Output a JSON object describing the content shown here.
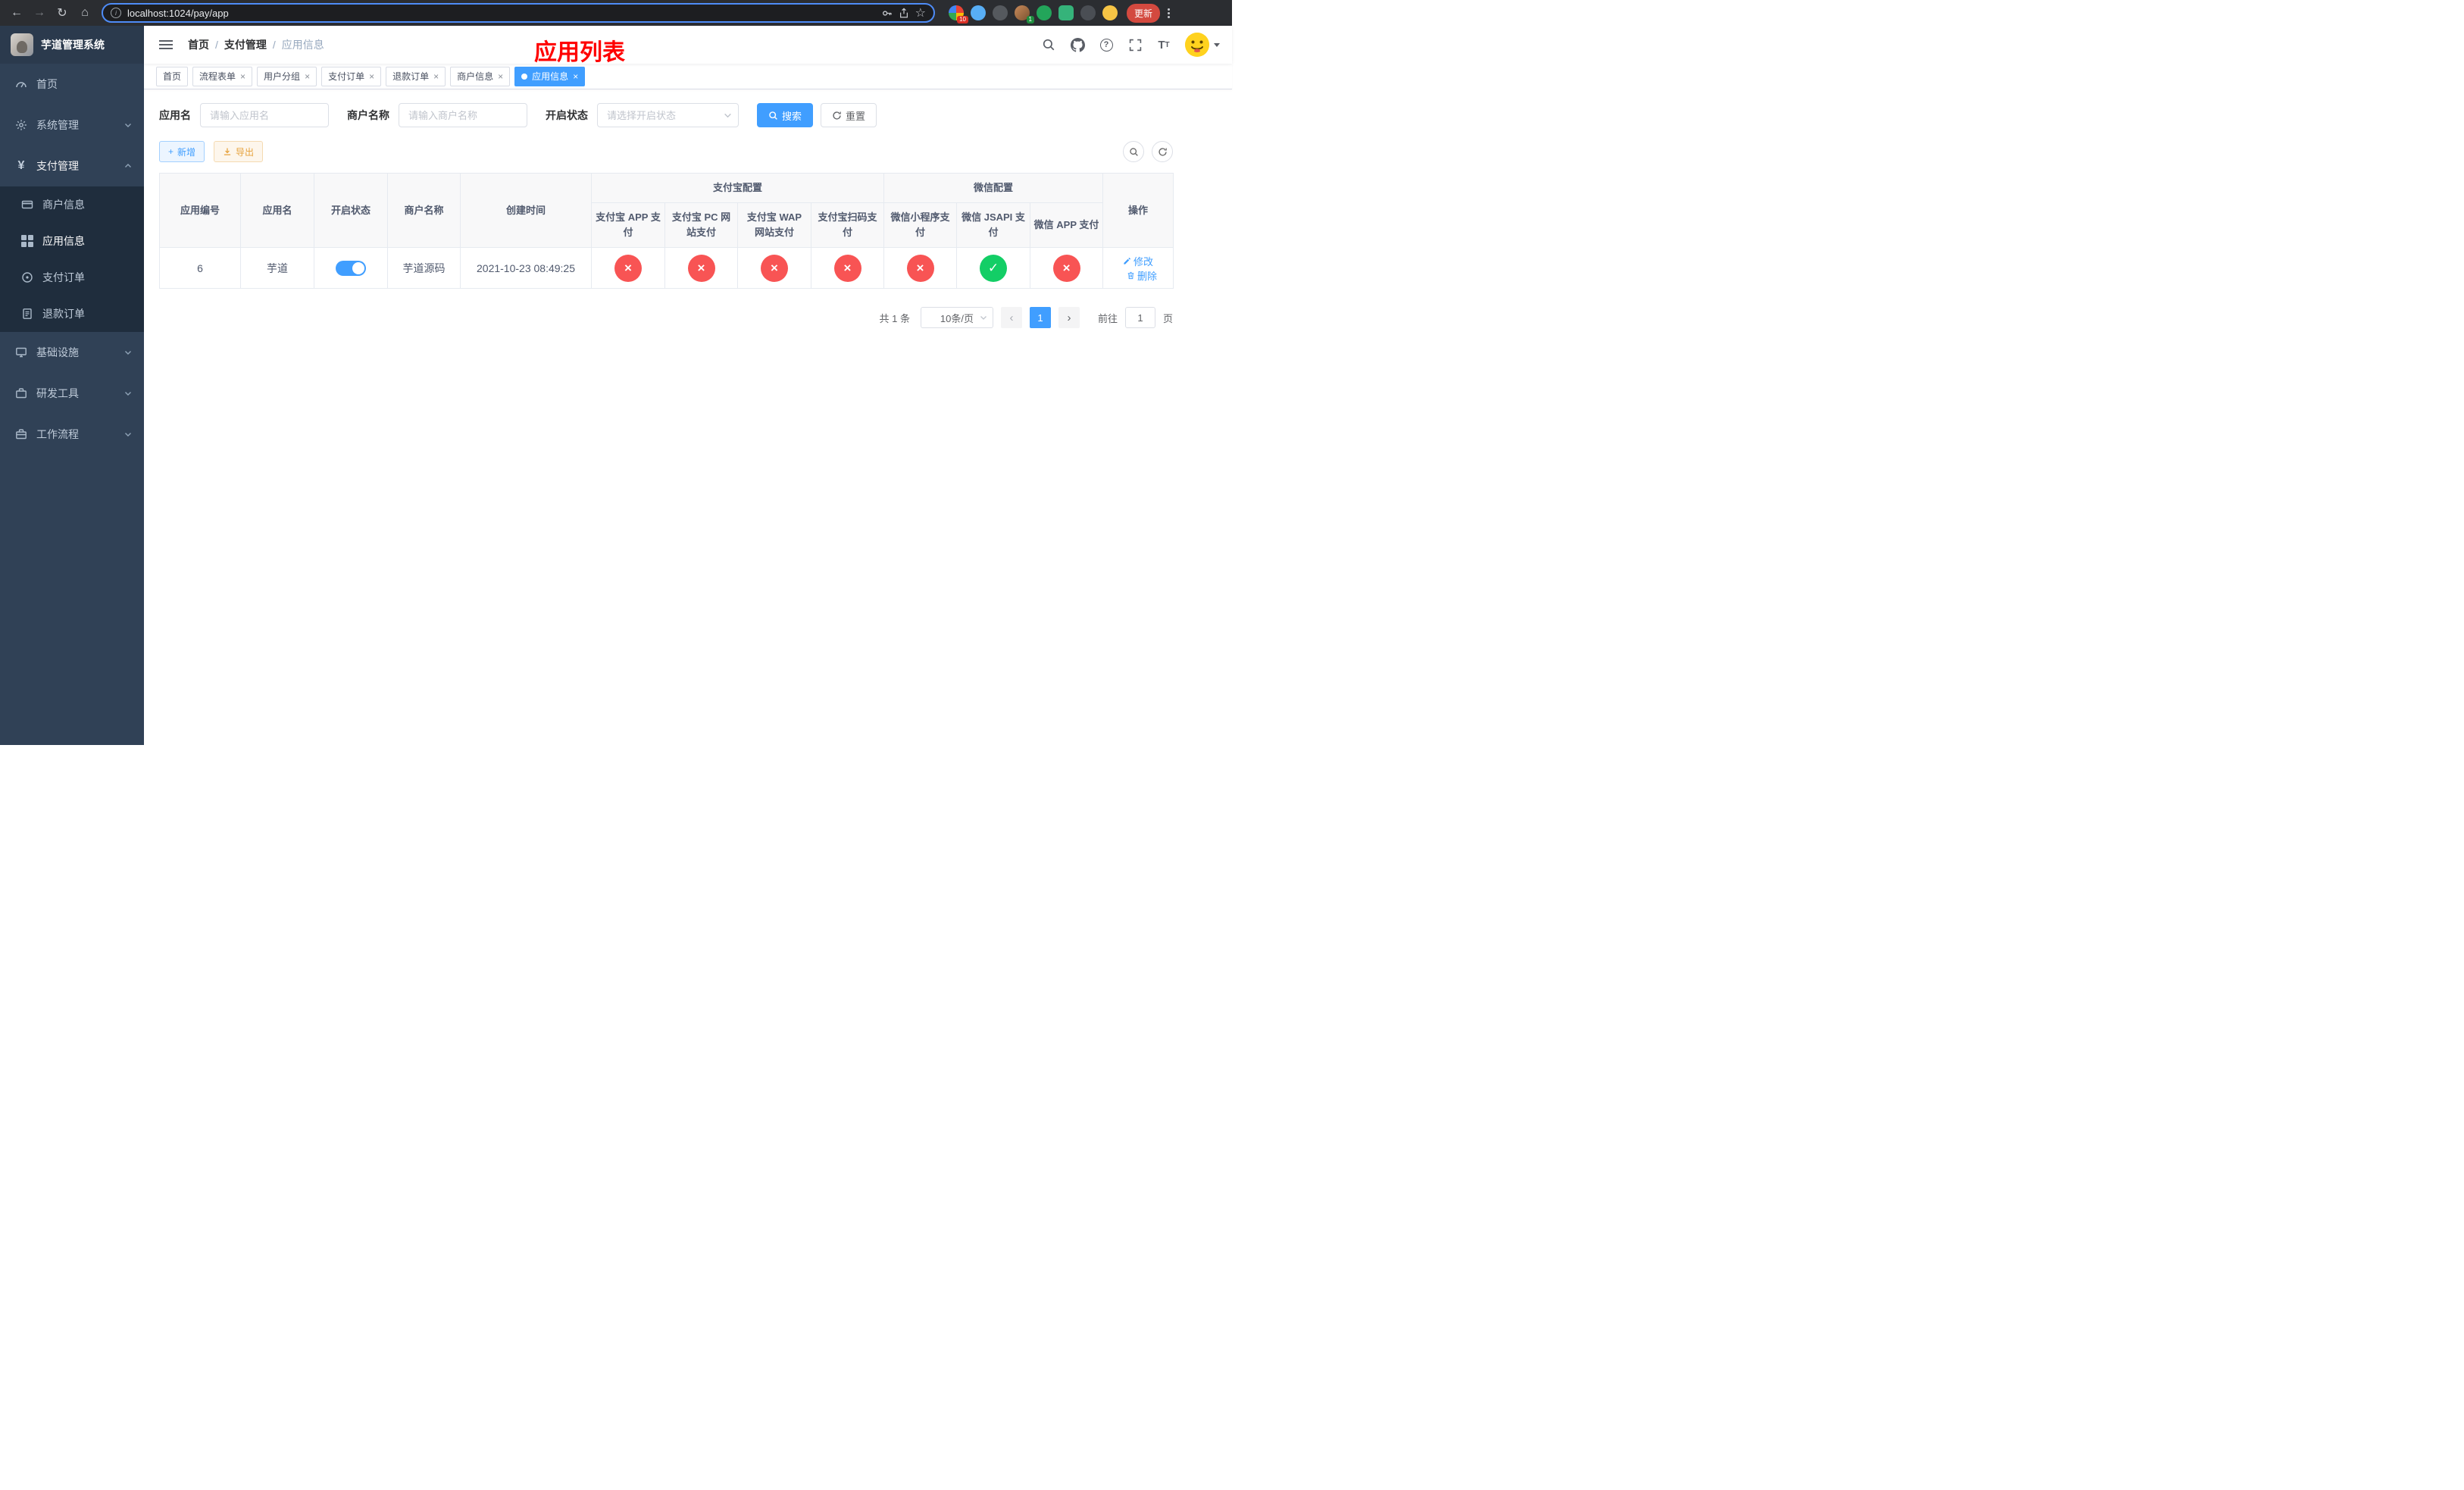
{
  "colors": {
    "accent": "#409eff",
    "danger": "#f85454",
    "success": "#13ce66",
    "warning": "#e6a23c",
    "title_red": "#ff0000"
  },
  "browser": {
    "url": "localhost:1024/pay/app",
    "update_label": "更新",
    "ext_badge_grid": "10",
    "ext_badge_avatar": "1"
  },
  "sidebar": {
    "title": "芋道管理系统",
    "menu": [
      {
        "label": "首页"
      },
      {
        "label": "系统管理"
      },
      {
        "label": "支付管理"
      },
      {
        "label": "基础设施"
      },
      {
        "label": "研发工具"
      },
      {
        "label": "工作流程"
      }
    ],
    "submenu": [
      {
        "label": "商户信息"
      },
      {
        "label": "应用信息"
      },
      {
        "label": "支付订单"
      },
      {
        "label": "退款订单"
      }
    ]
  },
  "header": {
    "breadcrumb": [
      {
        "label": "首页"
      },
      {
        "label": "支付管理"
      },
      {
        "label": "应用信息"
      }
    ],
    "page_title": "应用列表"
  },
  "tabs": [
    {
      "label": "首页"
    },
    {
      "label": "流程表单"
    },
    {
      "label": "用户分组"
    },
    {
      "label": "支付订单"
    },
    {
      "label": "退款订单"
    },
    {
      "label": "商户信息"
    },
    {
      "label": "应用信息"
    }
  ],
  "filters": {
    "app_name_label": "应用名",
    "app_name_placeholder": "请输入应用名",
    "merchant_label": "商户名称",
    "merchant_placeholder": "请输入商户名称",
    "status_label": "开启状态",
    "status_placeholder": "请选择开启状态",
    "search_label": "搜索",
    "reset_label": "重置"
  },
  "toolbar": {
    "add_label": "新增",
    "export_label": "导出"
  },
  "table": {
    "col_app_id": "应用编号",
    "col_app_name": "应用名",
    "col_status": "开启状态",
    "col_merchant": "商户名称",
    "col_created": "创建时间",
    "group_alipay": "支付宝配置",
    "group_wechat": "微信配置",
    "col_alipay_app": "支付宝 APP 支付",
    "col_alipay_pc": "支付宝 PC 网站付",
    "col_alipay_pc_full": "支付宝 PC 网站支付",
    "col_alipay_wap": "支付宝 WAP 网站支付",
    "col_alipay_qr": "支付宝扫码支付",
    "col_wx_mini": "微信小程序支付",
    "col_wx_jsapi": "微信 JSAPI 支付",
    "col_wx_app": "微信 APP 支付",
    "col_actions": "操作",
    "row": {
      "id": "6",
      "name": "芋道",
      "enabled": true,
      "merchant": "芋道源码",
      "created": "2021-10-23 08:49:25",
      "alipay_app": "no",
      "alipay_pc": "no",
      "alipay_wap": "no",
      "alipay_qr": "no",
      "wx_mini": "no",
      "wx_jsapi": "yes",
      "wx_app": "no",
      "edit_label": "修改",
      "delete_label": "删除"
    }
  },
  "pagination": {
    "total": "共 1 条",
    "page_size": "10条/页",
    "current_page": "1",
    "goto_label": "前往",
    "goto_value": "1",
    "unit_label": "页"
  }
}
